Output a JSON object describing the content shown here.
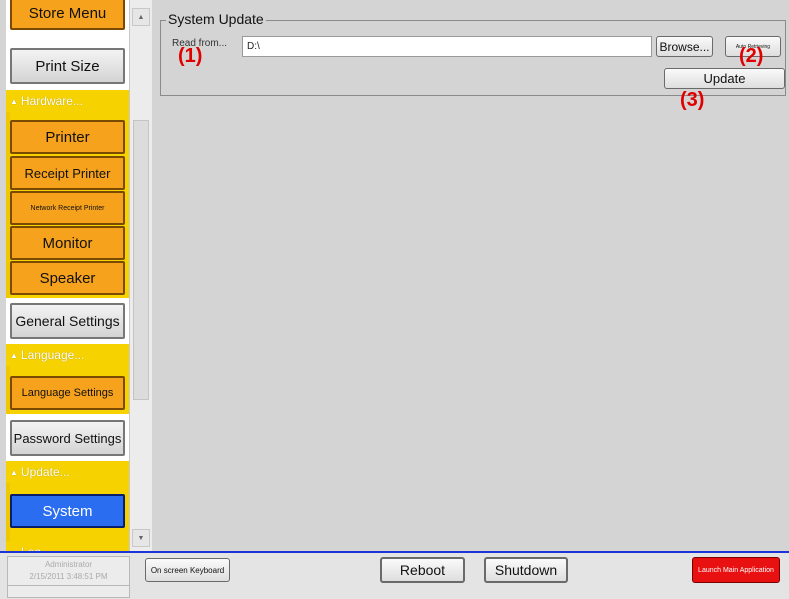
{
  "sidebar": {
    "store_menu": "Store Menu",
    "print_size": "Print Size",
    "hardware_group": "Hardware...",
    "printer": "Printer",
    "receipt_printer": "Receipt Printer",
    "network_receipt_printer": "Network Receipt Printer",
    "monitor": "Monitor",
    "speaker": "Speaker",
    "general_settings": "General Settings",
    "language_group": "Language...",
    "language_settings": "Language Settings",
    "password_settings": "Password Settings",
    "update_group": "Update...",
    "system": "System",
    "log_group": "Log..."
  },
  "main": {
    "group_title": "System Update",
    "read_from_label": "Read from...",
    "path_value": "D:\\",
    "browse_label": "Browse...",
    "auto_label": "Auto Retrieving",
    "update_label": "Update"
  },
  "annotations": {
    "one": "(1)",
    "two": "(2)",
    "three": "(3)"
  },
  "bottom": {
    "user": "Administrator",
    "datetime": "2/15/2011 3:48:51 PM",
    "keyboard_label": "On screen Keyboard",
    "reboot_label": "Reboot",
    "shutdown_label": "Shutdown",
    "launch_label": "Launch Main Application"
  },
  "colors": {
    "orange": "#f7a21c",
    "yellow": "#f6d300",
    "selected_blue": "#2a6df0",
    "launch_red": "#e81010",
    "annotation_red": "#e00000",
    "bottom_border_blue": "#1a35d8"
  },
  "icons": {
    "scroll_up": "triangle-up",
    "scroll_down": "triangle-down",
    "group_caret": "caret-up"
  }
}
